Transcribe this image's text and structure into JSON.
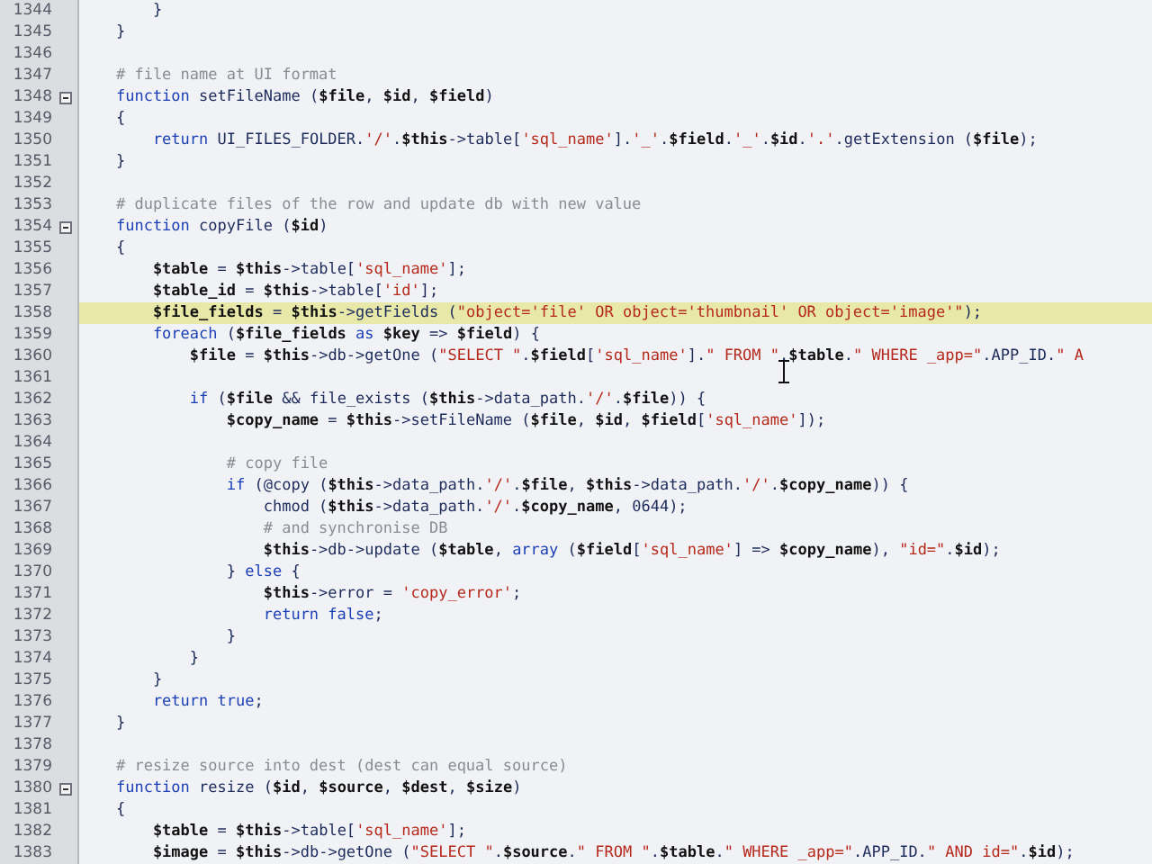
{
  "editor": {
    "lines": [
      {
        "number": "1344",
        "fold": false,
        "current": false,
        "tokens": [
          {
            "text": "        }",
            "kind": "plain"
          }
        ]
      },
      {
        "number": "1345",
        "fold": false,
        "current": false,
        "tokens": [
          {
            "text": "    }",
            "kind": "plain"
          }
        ]
      },
      {
        "number": "1346",
        "fold": false,
        "current": false
      },
      {
        "number": "1347",
        "fold": false,
        "current": false,
        "tokens": [
          {
            "text": "    # file name at UI format",
            "kind": "comment"
          }
        ]
      },
      {
        "number": "1348",
        "fold": true,
        "current": false,
        "tokens": [
          {
            "text": "    function",
            "kind": "keyword"
          },
          {
            "text": " setFileName (",
            "kind": "plain"
          },
          {
            "text": "$file",
            "kind": "variable"
          },
          {
            "text": ", ",
            "kind": "plain"
          },
          {
            "text": "$id",
            "kind": "variable"
          },
          {
            "text": ", ",
            "kind": "plain"
          },
          {
            "text": "$field",
            "kind": "variable"
          },
          {
            "text": ")",
            "kind": "plain"
          }
        ]
      },
      {
        "number": "1349",
        "fold": false,
        "current": false,
        "tokens": [
          {
            "text": "    {",
            "kind": "plain"
          }
        ]
      },
      {
        "number": "1350",
        "fold": false,
        "current": false,
        "tokens": [
          {
            "text": "        return",
            "kind": "keyword"
          },
          {
            "text": " UI_FILES_FOLDER.",
            "kind": "plain"
          },
          {
            "text": "'/'",
            "kind": "string"
          },
          {
            "text": ".",
            "kind": "plain"
          },
          {
            "text": "$this",
            "kind": "variable"
          },
          {
            "text": "->table[",
            "kind": "plain"
          },
          {
            "text": "'sql_name'",
            "kind": "string"
          },
          {
            "text": "].",
            "kind": "plain"
          },
          {
            "text": "'_'",
            "kind": "string"
          },
          {
            "text": ".",
            "kind": "plain"
          },
          {
            "text": "$field",
            "kind": "variable"
          },
          {
            "text": ".",
            "kind": "plain"
          },
          {
            "text": "'_'",
            "kind": "string"
          },
          {
            "text": ".",
            "kind": "plain"
          },
          {
            "text": "$id",
            "kind": "variable"
          },
          {
            "text": ".",
            "kind": "plain"
          },
          {
            "text": "'.'",
            "kind": "string"
          },
          {
            "text": ".getExtension (",
            "kind": "plain"
          },
          {
            "text": "$file",
            "kind": "variable"
          },
          {
            "text": ");",
            "kind": "plain"
          }
        ]
      },
      {
        "number": "1351",
        "fold": false,
        "current": false,
        "tokens": [
          {
            "text": "    }",
            "kind": "plain"
          }
        ]
      },
      {
        "number": "1352",
        "fold": false,
        "current": false
      },
      {
        "number": "1353",
        "fold": false,
        "current": false,
        "tokens": [
          {
            "text": "    # duplicate files of the row and update db with new value",
            "kind": "comment"
          }
        ]
      },
      {
        "number": "1354",
        "fold": true,
        "current": false,
        "tokens": [
          {
            "text": "    function",
            "kind": "keyword"
          },
          {
            "text": " copyFile (",
            "kind": "plain"
          },
          {
            "text": "$id",
            "kind": "variable"
          },
          {
            "text": ")",
            "kind": "plain"
          }
        ]
      },
      {
        "number": "1355",
        "fold": false,
        "current": false,
        "tokens": [
          {
            "text": "    {",
            "kind": "plain"
          }
        ]
      },
      {
        "number": "1356",
        "fold": false,
        "current": false,
        "tokens": [
          {
            "text": "        $table",
            "kind": "variable"
          },
          {
            "text": " = ",
            "kind": "plain"
          },
          {
            "text": "$this",
            "kind": "variable"
          },
          {
            "text": "->table[",
            "kind": "plain"
          },
          {
            "text": "'sql_name'",
            "kind": "string"
          },
          {
            "text": "];",
            "kind": "plain"
          }
        ]
      },
      {
        "number": "1357",
        "fold": false,
        "current": false,
        "tokens": [
          {
            "text": "        $table_id",
            "kind": "variable"
          },
          {
            "text": " = ",
            "kind": "plain"
          },
          {
            "text": "$this",
            "kind": "variable"
          },
          {
            "text": "->table[",
            "kind": "plain"
          },
          {
            "text": "'id'",
            "kind": "string"
          },
          {
            "text": "];",
            "kind": "plain"
          }
        ]
      },
      {
        "number": "1358",
        "fold": false,
        "current": true,
        "tokens": [
          {
            "text": "        $file_fields",
            "kind": "variable"
          },
          {
            "text": " = ",
            "kind": "plain"
          },
          {
            "text": "$this",
            "kind": "variable"
          },
          {
            "text": "->getFields (",
            "kind": "plain"
          },
          {
            "text": "\"object='file' OR object='thumbnail' OR object='image'\"",
            "kind": "string"
          },
          {
            "text": ");",
            "kind": "plain"
          }
        ]
      },
      {
        "number": "1359",
        "fold": false,
        "current": false,
        "tokens": [
          {
            "text": "        foreach",
            "kind": "keyword"
          },
          {
            "text": " (",
            "kind": "plain"
          },
          {
            "text": "$file_fields",
            "kind": "variable"
          },
          {
            "text": " as",
            "kind": "keyword"
          },
          {
            "text": " $key",
            "kind": "variable"
          },
          {
            "text": " => ",
            "kind": "plain"
          },
          {
            "text": "$field",
            "kind": "variable"
          },
          {
            "text": ") {",
            "kind": "plain"
          }
        ]
      },
      {
        "number": "1360",
        "fold": false,
        "current": false,
        "tokens": [
          {
            "text": "            $file",
            "kind": "variable"
          },
          {
            "text": " = ",
            "kind": "plain"
          },
          {
            "text": "$this",
            "kind": "variable"
          },
          {
            "text": "->db->getOne (",
            "kind": "plain"
          },
          {
            "text": "\"SELECT \"",
            "kind": "string"
          },
          {
            "text": ".",
            "kind": "plain"
          },
          {
            "text": "$field",
            "kind": "variable"
          },
          {
            "text": "[",
            "kind": "plain"
          },
          {
            "text": "'sql_name'",
            "kind": "string"
          },
          {
            "text": "].",
            "kind": "plain"
          },
          {
            "text": "\" FROM \"",
            "kind": "string"
          },
          {
            "text": ".",
            "kind": "plain"
          },
          {
            "text": "$table",
            "kind": "variable"
          },
          {
            "text": ".",
            "kind": "plain"
          },
          {
            "text": "\" WHERE _app=\"",
            "kind": "string"
          },
          {
            "text": ".APP_ID.",
            "kind": "plain"
          },
          {
            "text": "\" A",
            "kind": "string"
          }
        ]
      },
      {
        "number": "1361",
        "fold": false,
        "current": false
      },
      {
        "number": "1362",
        "fold": false,
        "current": false,
        "tokens": [
          {
            "text": "            if",
            "kind": "keyword"
          },
          {
            "text": " (",
            "kind": "plain"
          },
          {
            "text": "$file",
            "kind": "variable"
          },
          {
            "text": " && file_exists (",
            "kind": "plain"
          },
          {
            "text": "$this",
            "kind": "variable"
          },
          {
            "text": "->data_path.",
            "kind": "plain"
          },
          {
            "text": "'/'",
            "kind": "string"
          },
          {
            "text": ".",
            "kind": "plain"
          },
          {
            "text": "$file",
            "kind": "variable"
          },
          {
            "text": ")) {",
            "kind": "plain"
          }
        ]
      },
      {
        "number": "1363",
        "fold": false,
        "current": false,
        "tokens": [
          {
            "text": "                $copy_name",
            "kind": "variable"
          },
          {
            "text": " = ",
            "kind": "plain"
          },
          {
            "text": "$this",
            "kind": "variable"
          },
          {
            "text": "->setFileName (",
            "kind": "plain"
          },
          {
            "text": "$file",
            "kind": "variable"
          },
          {
            "text": ", ",
            "kind": "plain"
          },
          {
            "text": "$id",
            "kind": "variable"
          },
          {
            "text": ", ",
            "kind": "plain"
          },
          {
            "text": "$field",
            "kind": "variable"
          },
          {
            "text": "[",
            "kind": "plain"
          },
          {
            "text": "'sql_name'",
            "kind": "string"
          },
          {
            "text": "]);",
            "kind": "plain"
          }
        ]
      },
      {
        "number": "1364",
        "fold": false,
        "current": false
      },
      {
        "number": "1365",
        "fold": false,
        "current": false,
        "tokens": [
          {
            "text": "                # copy file",
            "kind": "comment"
          }
        ]
      },
      {
        "number": "1366",
        "fold": false,
        "current": false,
        "tokens": [
          {
            "text": "                if",
            "kind": "keyword"
          },
          {
            "text": " (@copy (",
            "kind": "plain"
          },
          {
            "text": "$this",
            "kind": "variable"
          },
          {
            "text": "->data_path.",
            "kind": "plain"
          },
          {
            "text": "'/'",
            "kind": "string"
          },
          {
            "text": ".",
            "kind": "plain"
          },
          {
            "text": "$file",
            "kind": "variable"
          },
          {
            "text": ", ",
            "kind": "plain"
          },
          {
            "text": "$this",
            "kind": "variable"
          },
          {
            "text": "->data_path.",
            "kind": "plain"
          },
          {
            "text": "'/'",
            "kind": "string"
          },
          {
            "text": ".",
            "kind": "plain"
          },
          {
            "text": "$copy_name",
            "kind": "variable"
          },
          {
            "text": ")) {",
            "kind": "plain"
          }
        ]
      },
      {
        "number": "1367",
        "fold": false,
        "current": false,
        "tokens": [
          {
            "text": "                    chmod (",
            "kind": "plain"
          },
          {
            "text": "$this",
            "kind": "variable"
          },
          {
            "text": "->data_path.",
            "kind": "plain"
          },
          {
            "text": "'/'",
            "kind": "string"
          },
          {
            "text": ".",
            "kind": "plain"
          },
          {
            "text": "$copy_name",
            "kind": "variable"
          },
          {
            "text": ", 0644);",
            "kind": "plain"
          }
        ]
      },
      {
        "number": "1368",
        "fold": false,
        "current": false,
        "tokens": [
          {
            "text": "                    # and synchronise DB",
            "kind": "comment"
          }
        ]
      },
      {
        "number": "1369",
        "fold": false,
        "current": false,
        "tokens": [
          {
            "text": "                    $this",
            "kind": "variable"
          },
          {
            "text": "->db->update (",
            "kind": "plain"
          },
          {
            "text": "$table",
            "kind": "variable"
          },
          {
            "text": ", ",
            "kind": "plain"
          },
          {
            "text": "array",
            "kind": "keyword"
          },
          {
            "text": " (",
            "kind": "plain"
          },
          {
            "text": "$field",
            "kind": "variable"
          },
          {
            "text": "[",
            "kind": "plain"
          },
          {
            "text": "'sql_name'",
            "kind": "string"
          },
          {
            "text": "] => ",
            "kind": "plain"
          },
          {
            "text": "$copy_name",
            "kind": "variable"
          },
          {
            "text": "), ",
            "kind": "plain"
          },
          {
            "text": "\"id=\"",
            "kind": "string"
          },
          {
            "text": ".",
            "kind": "plain"
          },
          {
            "text": "$id",
            "kind": "variable"
          },
          {
            "text": ");",
            "kind": "plain"
          }
        ]
      },
      {
        "number": "1370",
        "fold": false,
        "current": false,
        "tokens": [
          {
            "text": "                } ",
            "kind": "plain"
          },
          {
            "text": "else",
            "kind": "keyword"
          },
          {
            "text": " {",
            "kind": "plain"
          }
        ]
      },
      {
        "number": "1371",
        "fold": false,
        "current": false,
        "tokens": [
          {
            "text": "                    $this",
            "kind": "variable"
          },
          {
            "text": "->error = ",
            "kind": "plain"
          },
          {
            "text": "'copy_error'",
            "kind": "string"
          },
          {
            "text": ";",
            "kind": "plain"
          }
        ]
      },
      {
        "number": "1372",
        "fold": false,
        "current": false,
        "tokens": [
          {
            "text": "                    return false",
            "kind": "keyword"
          },
          {
            "text": ";",
            "kind": "plain"
          }
        ]
      },
      {
        "number": "1373",
        "fold": false,
        "current": false,
        "tokens": [
          {
            "text": "                }",
            "kind": "plain"
          }
        ]
      },
      {
        "number": "1374",
        "fold": false,
        "current": false,
        "tokens": [
          {
            "text": "            }",
            "kind": "plain"
          }
        ]
      },
      {
        "number": "1375",
        "fold": false,
        "current": false,
        "tokens": [
          {
            "text": "        }",
            "kind": "plain"
          }
        ]
      },
      {
        "number": "1376",
        "fold": false,
        "current": false,
        "tokens": [
          {
            "text": "        return true",
            "kind": "keyword"
          },
          {
            "text": ";",
            "kind": "plain"
          }
        ]
      },
      {
        "number": "1377",
        "fold": false,
        "current": false,
        "tokens": [
          {
            "text": "    }",
            "kind": "plain"
          }
        ]
      },
      {
        "number": "1378",
        "fold": false,
        "current": false
      },
      {
        "number": "1379",
        "fold": false,
        "current": false,
        "tokens": [
          {
            "text": "    # resize source into dest (dest can equal source)",
            "kind": "comment"
          }
        ]
      },
      {
        "number": "1380",
        "fold": true,
        "current": false,
        "tokens": [
          {
            "text": "    function",
            "kind": "keyword"
          },
          {
            "text": " resize (",
            "kind": "plain"
          },
          {
            "text": "$id",
            "kind": "variable"
          },
          {
            "text": ", ",
            "kind": "plain"
          },
          {
            "text": "$source",
            "kind": "variable"
          },
          {
            "text": ", ",
            "kind": "plain"
          },
          {
            "text": "$dest",
            "kind": "variable"
          },
          {
            "text": ", ",
            "kind": "plain"
          },
          {
            "text": "$size",
            "kind": "variable"
          },
          {
            "text": ")",
            "kind": "plain"
          }
        ]
      },
      {
        "number": "1381",
        "fold": false,
        "current": false,
        "tokens": [
          {
            "text": "    {",
            "kind": "plain"
          }
        ]
      },
      {
        "number": "1382",
        "fold": false,
        "current": false,
        "tokens": [
          {
            "text": "        $table",
            "kind": "variable"
          },
          {
            "text": " = ",
            "kind": "plain"
          },
          {
            "text": "$this",
            "kind": "variable"
          },
          {
            "text": "->table[",
            "kind": "plain"
          },
          {
            "text": "'sql_name'",
            "kind": "string"
          },
          {
            "text": "];",
            "kind": "plain"
          }
        ]
      },
      {
        "number": "1383",
        "fold": false,
        "current": false,
        "tokens": [
          {
            "text": "        $image",
            "kind": "variable"
          },
          {
            "text": " = ",
            "kind": "plain"
          },
          {
            "text": "$this",
            "kind": "variable"
          },
          {
            "text": "->db->getOne (",
            "kind": "plain"
          },
          {
            "text": "\"SELECT \"",
            "kind": "string"
          },
          {
            "text": ".",
            "kind": "plain"
          },
          {
            "text": "$source",
            "kind": "variable"
          },
          {
            "text": ".",
            "kind": "plain"
          },
          {
            "text": "\" FROM \"",
            "kind": "string"
          },
          {
            "text": ".",
            "kind": "plain"
          },
          {
            "text": "$table",
            "kind": "variable"
          },
          {
            "text": ".",
            "kind": "plain"
          },
          {
            "text": "\" WHERE _app=\"",
            "kind": "string"
          },
          {
            "text": ".APP_ID.",
            "kind": "plain"
          },
          {
            "text": "\" AND id=\"",
            "kind": "string"
          },
          {
            "text": ".",
            "kind": "plain"
          },
          {
            "text": "$id",
            "kind": "variable"
          },
          {
            "text": ");",
            "kind": "plain"
          }
        ]
      }
    ]
  }
}
